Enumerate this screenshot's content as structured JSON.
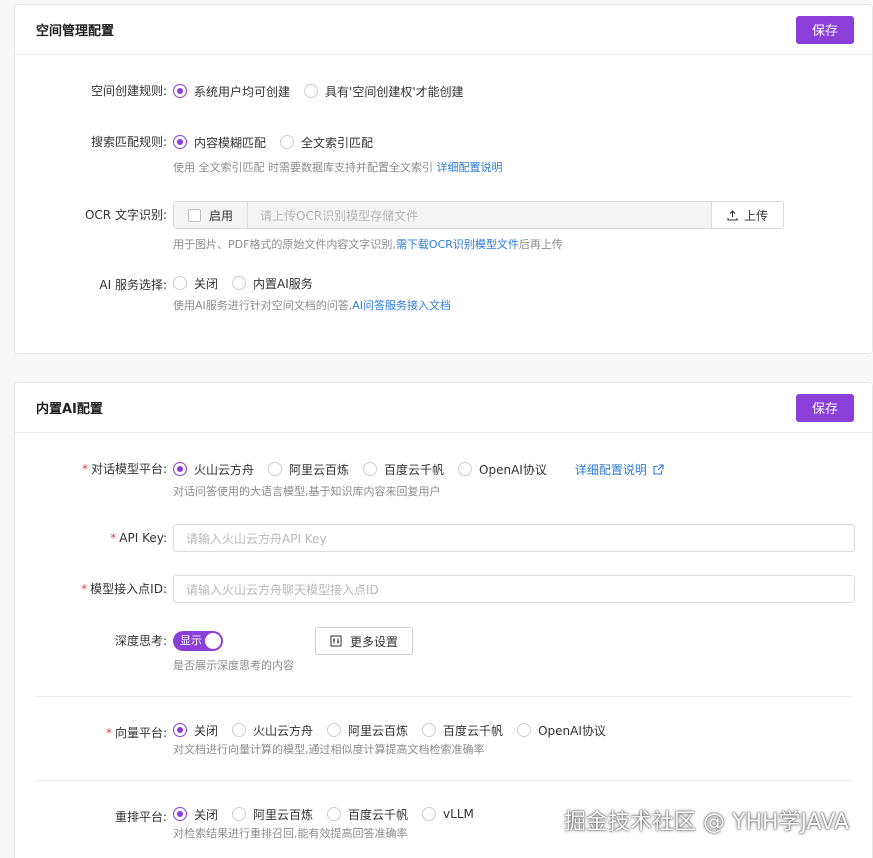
{
  "colors": {
    "accent": "#8a3fd8",
    "link": "#2d7bd6",
    "required": "#e0453a"
  },
  "space_card": {
    "title": "空间管理配置",
    "save_label": "保存",
    "create_rule": {
      "label": "空间创建规则:",
      "options": [
        "系统用户均可创建",
        "具有'空间创建权'才能创建"
      ],
      "selected": 0
    },
    "search_rule": {
      "label": "搜索匹配规则:",
      "options": [
        "内容模糊匹配",
        "全文索引匹配"
      ],
      "selected": 0,
      "hint_prefix": "使用 全文索引匹配 时需要数据库支持并配置全文索引",
      "hint_link": "详细配置说明"
    },
    "ocr": {
      "label": "OCR 文字识别:",
      "checkbox_label": "启用",
      "placeholder": "请上传OCR识别模型存储文件",
      "upload_label": "上传",
      "hint_prefix": "用于图片、PDF格式的原始文件内容文字识别,",
      "hint_link": "需下载OCR识别模型文件",
      "hint_suffix": "后再上传"
    },
    "ai_service": {
      "label": "AI 服务选择:",
      "options": [
        "关闭",
        "内置AI服务"
      ],
      "selected": -1,
      "hint_prefix": "使用AI服务进行针对空间文档的问答,",
      "hint_link": "AI问答服务接入文档"
    }
  },
  "ai_card": {
    "title": "内置AI配置",
    "save_label": "保存",
    "chat_platform": {
      "label": "对话模型平台:",
      "options": [
        "火山云方舟",
        "阿里云百炼",
        "百度云千帆",
        "OpenAI协议"
      ],
      "selected": 0,
      "doc_link": "详细配置说明",
      "hint": "对话问答使用的大语言模型,基于知识库内容来回复用户"
    },
    "api_key": {
      "label": "API Key:",
      "placeholder": "请输入火山云方舟API Key"
    },
    "endpoint": {
      "label": "模型接入点ID:",
      "placeholder": "请输入火山云方舟聊天模型接入点ID"
    },
    "deep_think": {
      "label": "深度思考:",
      "toggle_label": "显示",
      "toggle_on": true,
      "more_label": "更多设置",
      "hint": "是否展示深度思考的内容"
    },
    "vector_platform": {
      "label": "向量平台:",
      "options": [
        "关闭",
        "火山云方舟",
        "阿里云百炼",
        "百度云千帆",
        "OpenAI协议"
      ],
      "selected": 0,
      "hint": "对文档进行向量计算的模型,通过相似度计算提高文档检索准确率"
    },
    "rerank_platform": {
      "label": "重排平台:",
      "options": [
        "关闭",
        "阿里云百炼",
        "百度云千帆",
        "vLLM"
      ],
      "selected": 0,
      "hint": "对检索结果进行重排召回,能有效提高回答准确率"
    }
  },
  "watermark": "掘金技术社区 @ YHH学JAVA"
}
